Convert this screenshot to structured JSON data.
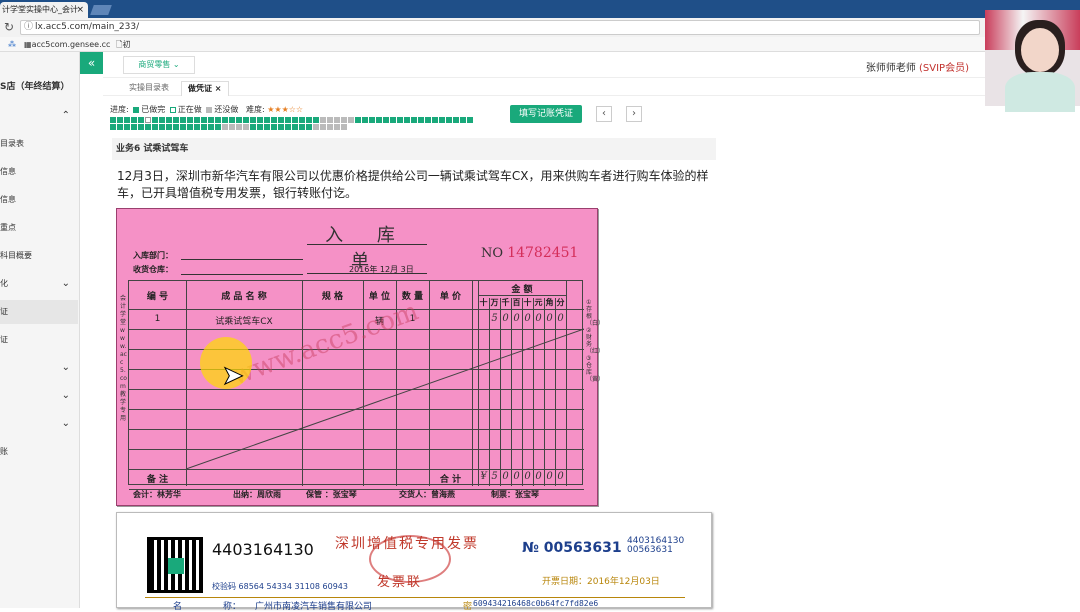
{
  "browser": {
    "tab_title": "计学堂实操中心_会计",
    "tab_close": "×",
    "url": "lx.acc5.com/main_233/",
    "bookmarks": [
      "acc5com.gensee.cc",
      "初级"
    ]
  },
  "sidebar": {
    "collapse_icon": "«",
    "title": "S店（年终结算）",
    "items": [
      {
        "label": "",
        "chevron": "⌃"
      },
      {
        "label": "目录表"
      },
      {
        "label": "信息"
      },
      {
        "label": "信息"
      },
      {
        "label": "重点"
      },
      {
        "label": "科目概要"
      },
      {
        "label": "化",
        "chevron": "⌄"
      },
      {
        "label": "证",
        "active": true
      },
      {
        "label": "证"
      },
      {
        "label": "",
        "chevron": "⌄"
      },
      {
        "label": "",
        "chevron": "⌄"
      },
      {
        "label": "",
        "chevron": "⌄"
      },
      {
        "label": "账"
      },
      {
        "label": ""
      }
    ]
  },
  "topbar": {
    "dropdown": "商贸零售",
    "teacher": "张师师老师",
    "member": "(SVIP会员)"
  },
  "tabs": [
    "实操目录表",
    "做凭证"
  ],
  "tab_close": "×",
  "progress": {
    "label": "进度:",
    "done": "已做完",
    "doing": "正在做",
    "todo": "还没做",
    "difficulty": "难度:"
  },
  "actions": {
    "fill_voucher": "填写记账凭证",
    "prev": "‹",
    "next": "›"
  },
  "task": {
    "header": "业务6 试乘试驾车",
    "description": "12月3日，深圳市新华汽车有限公司以优惠价格提供给公司一辆试乘试驾车CX，用来供购车者进行购车体验的样车，已开具增值税专用发票，银行转账付讫。"
  },
  "receipt": {
    "title": "入 库 单",
    "no_label": "NO",
    "no": "14782451",
    "dept_label": "入库部门：",
    "warehouse_label": "收货仓库：",
    "date": "2016年 12月 3日",
    "headers": {
      "code": "编 号",
      "name": "成 品 名 称",
      "spec": "规 格",
      "unit": "单 位",
      "qty": "数 量",
      "price": "单 价",
      "amount": "金 额"
    },
    "digit_headers": [
      "十",
      "万",
      "千",
      "百",
      "十",
      "元",
      "角",
      "分"
    ],
    "row": {
      "code": "1",
      "name": "试乘试驾车CX",
      "unit": "辆",
      "qty": "1",
      "digits": [
        "",
        "5",
        "0",
        "0",
        "0",
        "0",
        "0",
        "0"
      ]
    },
    "remark_label": "备 注",
    "total_label": "合 计",
    "total_digits": [
      "¥",
      "5",
      "0",
      "0",
      "0",
      "0",
      "0",
      "0"
    ],
    "side_text": "会计学堂www.acc5.com教学专用",
    "copy_text": "①存根（白）②财务（红）③仓库（黄）",
    "watermark": "www.acc5.com",
    "footer": {
      "accountant": "会计：林芳华",
      "out": "出纳：周欣雨",
      "keeper": "保管 ：张宝琴",
      "deliverer": "交货人：曾海燕",
      "maker": "制票：张宝琴"
    }
  },
  "invoice": {
    "code": "4403164130",
    "title": "深圳增值税专用发票",
    "subtitle": "发票联",
    "no_label": "№",
    "no": "00563631",
    "small_code": "4403164130",
    "small_no": "00563631",
    "date": "开票日期：2016年12月03日",
    "check": "校验码 68564 54334 31108 60943",
    "buyer_label": "名",
    "buyer_label2": "称：",
    "buyer": "广州市南凌汽车销售有限公司",
    "cipher_label": "密",
    "cipher": "6094342164​68c0b64fc7fd82e6"
  },
  "colors": {
    "accent": "#19a97b",
    "receipt_bg": "#f591c6",
    "invoice_red": "#c0392b"
  }
}
